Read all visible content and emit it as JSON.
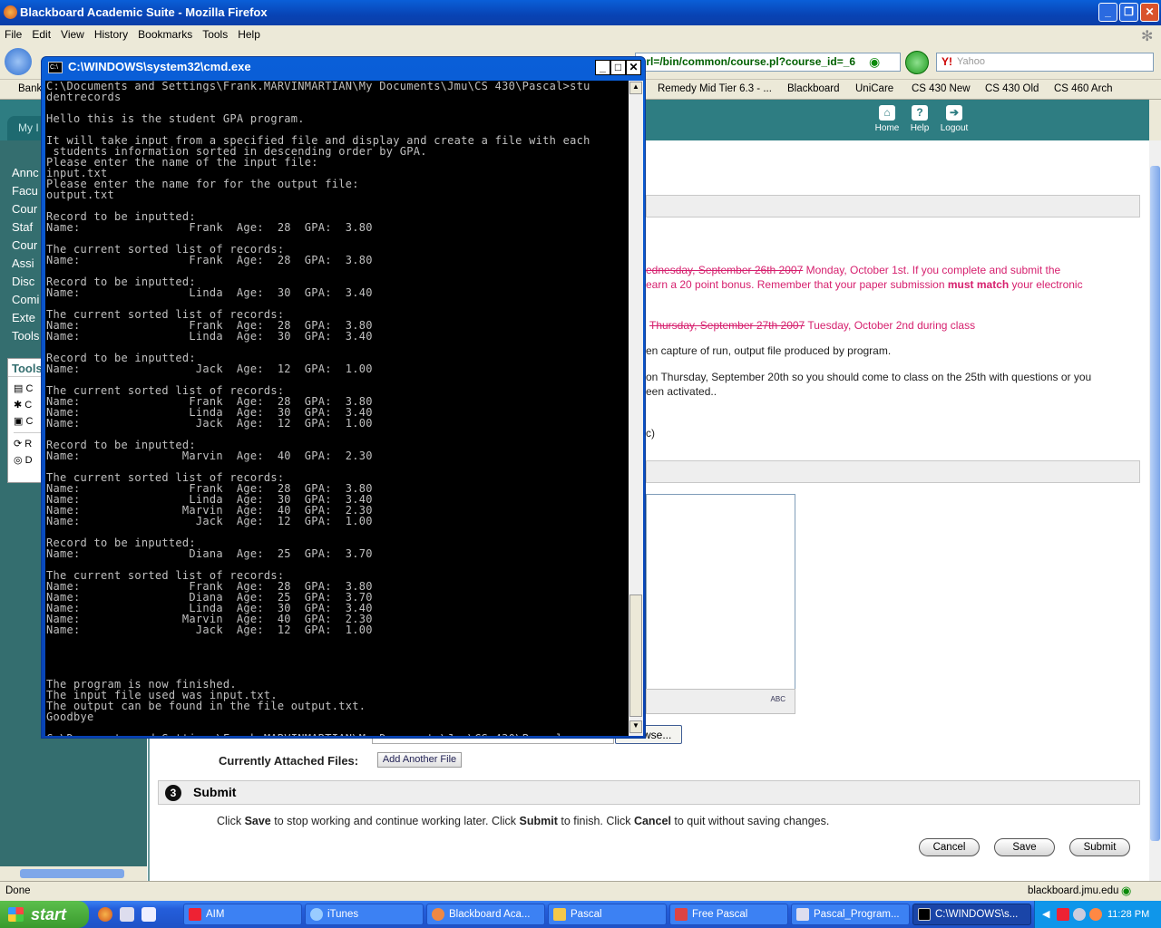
{
  "firefox": {
    "title": "Blackboard Academic Suite - Mozilla Firefox",
    "menu": [
      "File",
      "Edit",
      "View",
      "History",
      "Bookmarks",
      "Tools",
      "Help"
    ],
    "url": "url=/bin/common/course.pl?course_id=_6",
    "search_placeholder": "Yahoo",
    "bookmarks": [
      "Bank",
      "Remedy Mid Tier 6.3 - ...",
      "Blackboard",
      "UniCare",
      "CS 430 New",
      "CS 430 Old",
      "CS 460 Arch"
    ],
    "status": "Done",
    "status_host": "blackboard.jmu.edu"
  },
  "blackboard": {
    "tab": "My I",
    "header_icons": [
      "Home",
      "Help",
      "Logout"
    ],
    "nav": [
      "Annc",
      "Facu",
      "Cour",
      "Staf",
      "Cour",
      "Assi",
      "Disc",
      "Comi",
      "Exte",
      "Tools"
    ],
    "tools_title": "Tools",
    "tools_items": [
      "C",
      "C",
      "C",
      "R",
      "D"
    ],
    "due_line1_struck": "ednesday, September 26th 2007",
    "due_line1_rest": " Monday, October 1st.  If you complete and submit the",
    "due_line2": "earn a 20 point bonus.  Remember that your paper submission ",
    "due_line2_bold": "must match",
    "due_line2_end": " your electronic",
    "due_line3_struck": "Thursday, September 27th 2007",
    "due_line3_rest": " Tuesday, October 2nd   during class",
    "capture_line": "en capture of run,  output file produced by program.",
    "thursday_line1": "on Thursday, September 20th so you should come to class on the 25th with questions or you",
    "thursday_line2": "een activated..",
    "paren": "c)",
    "browse_label": "wse...",
    "attached_label": "Currently Attached Files:",
    "add_file_label": "Add Another File",
    "submit_num": "3",
    "submit_title": "Submit",
    "submit_instr_1": "Click ",
    "submit_instr_save": "Save",
    "submit_instr_2": " to stop working and continue working later. Click ",
    "submit_instr_submit": "Submit",
    "submit_instr_3": " to finish. Click ",
    "submit_instr_cancel": "Cancel",
    "submit_instr_4": " to quit without saving changes.",
    "cancel_label": "Cancel",
    "save_label": "Save",
    "submit_label": "Submit",
    "spellcheck": "ABC"
  },
  "cmd": {
    "title": "C:\\WINDOWS\\system32\\cmd.exe",
    "output": "C:\\Documents and Settings\\Frank.MARVINMARTIAN\\My Documents\\Jmu\\CS 430\\Pascal>stu\ndentrecords\n\nHello this is the student GPA program.\n\nIt will take input from a specified file and display and create a file with each\n students information sorted in descending order by GPA.\nPlease enter the name of the input file:\ninput.txt\nPlease enter the name for for the output file:\noutput.txt\n\nRecord to be inputted:\nName:                Frank  Age:  28  GPA:  3.80\n\nThe current sorted list of records:\nName:                Frank  Age:  28  GPA:  3.80\n\nRecord to be inputted:\nName:                Linda  Age:  30  GPA:  3.40\n\nThe current sorted list of records:\nName:                Frank  Age:  28  GPA:  3.80\nName:                Linda  Age:  30  GPA:  3.40\n\nRecord to be inputted:\nName:                 Jack  Age:  12  GPA:  1.00\n\nThe current sorted list of records:\nName:                Frank  Age:  28  GPA:  3.80\nName:                Linda  Age:  30  GPA:  3.40\nName:                 Jack  Age:  12  GPA:  1.00\n\nRecord to be inputted:\nName:               Marvin  Age:  40  GPA:  2.30\n\nThe current sorted list of records:\nName:                Frank  Age:  28  GPA:  3.80\nName:                Linda  Age:  30  GPA:  3.40\nName:               Marvin  Age:  40  GPA:  2.30\nName:                 Jack  Age:  12  GPA:  1.00\n\nRecord to be inputted:\nName:                Diana  Age:  25  GPA:  3.70\n\nThe current sorted list of records:\nName:                Frank  Age:  28  GPA:  3.80\nName:                Diana  Age:  25  GPA:  3.70\nName:                Linda  Age:  30  GPA:  3.40\nName:               Marvin  Age:  40  GPA:  2.30\nName:                 Jack  Age:  12  GPA:  1.00\n\n\n\n\nThe program is now finished.\nThe input file used was input.txt.\nThe output can be found in the file output.txt.\nGoodbye\n\nC:\\Documents and Settings\\Frank.MARVINMARTIAN\\My Documents\\Jmu\\CS 430\\Pascal>_"
  },
  "taskbar": {
    "start": "start",
    "tasks": [
      "AIM",
      "iTunes",
      "Blackboard Aca...",
      "Pascal",
      "Free Pascal",
      "Pascal_Program...",
      "C:\\WINDOWS\\s..."
    ],
    "clock": "11:28 PM"
  }
}
